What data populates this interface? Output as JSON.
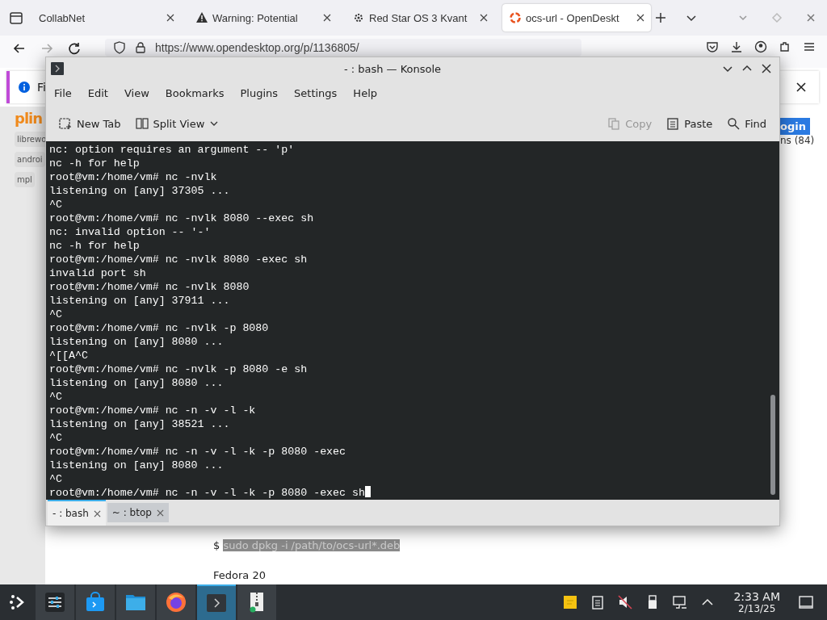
{
  "browser": {
    "tabs": [
      {
        "title": "CollabNet",
        "selected": false
      },
      {
        "title": "Warning: Potential",
        "selected": false
      },
      {
        "title": "Red Star OS 3 Kvant",
        "selected": false
      },
      {
        "title": "ocs-url - OpenDeskt",
        "selected": true
      }
    ],
    "url": "https://www.opendesktop.org/p/1136805/",
    "notification": "Fi",
    "page": {
      "logo": "plin",
      "tags": [
        "librewo",
        "androi",
        "mpl"
      ],
      "login_button": "ogin",
      "count_text": "ns (84)",
      "prompt": "$",
      "command": "sudo dpkg -i /path/to/ocs-url*.deb",
      "heading": "Fedora 20"
    }
  },
  "konsole": {
    "title": "- : bash — Konsole",
    "menu": [
      "File",
      "Edit",
      "View",
      "Bookmarks",
      "Plugins",
      "Settings",
      "Help"
    ],
    "toolbar": [
      {
        "label": "New Tab",
        "kind": "newtab",
        "disabled": false
      },
      {
        "label": "Split View",
        "kind": "split",
        "disabled": false
      },
      {
        "label": "Copy",
        "kind": "copy",
        "disabled": true
      },
      {
        "label": "Paste",
        "kind": "paste",
        "disabled": false
      },
      {
        "label": "Find",
        "kind": "find",
        "disabled": false
      }
    ],
    "lines": [
      "nc: option requires an argument -- 'p'",
      "nc -h for help",
      "root@vm:/home/vm# nc -nvlk",
      "listening on [any] 37305 ...",
      "^C",
      "root@vm:/home/vm# nc -nvlk 8080 --exec sh",
      "nc: invalid option -- '-'",
      "nc -h for help",
      "root@vm:/home/vm# nc -nvlk 8080 -exec sh",
      "invalid port sh",
      "root@vm:/home/vm# nc -nvlk 8080",
      "listening on [any] 37911 ...",
      "^C",
      "root@vm:/home/vm# nc -nvlk -p 8080",
      "listening on [any] 8080 ...",
      "^[[A^C",
      "root@vm:/home/vm# nc -nvlk -p 8080 -e sh",
      "listening on [any] 8080 ...",
      "^C",
      "root@vm:/home/vm# nc -n -v -l -k",
      "listening on [any] 38521 ...",
      "^C",
      "root@vm:/home/vm# nc -n -v -l -k -p 8080 -exec",
      "listening on [any] 8080 ...",
      "^C",
      "root@vm:/home/vm# nc -n -v -l -k -p 8080 -exec sh"
    ],
    "tabs": [
      {
        "label": "- : bash",
        "selected": true
      },
      {
        "label": "~ : btop",
        "selected": false
      }
    ]
  },
  "taskbar": {
    "apps": [
      {
        "kind": "settings",
        "active": false
      },
      {
        "kind": "store",
        "active": false
      },
      {
        "kind": "files",
        "active": false
      },
      {
        "kind": "browser",
        "active": false
      },
      {
        "kind": "terminal",
        "active": true
      },
      {
        "kind": "archive",
        "active": false
      }
    ],
    "clock": {
      "time": "2:33 AM",
      "date": "2/13/25"
    }
  }
}
